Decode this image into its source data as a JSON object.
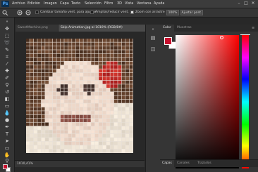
{
  "menubar": {
    "logo": "Ps",
    "items": [
      "Archivo",
      "Edición",
      "Imagen",
      "Capa",
      "Texto",
      "Selección",
      "Filtro",
      "3D",
      "Vista",
      "Ventana",
      "Ayuda"
    ],
    "window_controls": [
      "–",
      "□",
      "✕"
    ]
  },
  "options": {
    "resize_windows": "Cambiar tamaño vent. para ajustar",
    "zoom_all": "Ampliar/reducir vent.",
    "scrubby_zoom": "Zoom con arrastre",
    "percent": "100%",
    "fit_screen": "Ajustar pant."
  },
  "tabs": {
    "tab1": "SweetMachine.png",
    "tab2": "Skip Animation.jpg al 1010% (RGB/8#)"
  },
  "status": {
    "zoom": "1010,41%"
  },
  "color_panel": {
    "tab_color": "Color",
    "tab_swatches": "Muestras",
    "fg_color": "#c8102e",
    "bg_color": "#ffffff"
  },
  "bottom_tabs": {
    "layers": "Capas",
    "channels": "Canales",
    "paths": "Trazados"
  },
  "icons": {
    "tools": [
      "move-icon",
      "marquee-icon",
      "lasso-icon",
      "quick-select-icon",
      "crop-icon",
      "eyedropper-icon",
      "healing-icon",
      "brush-icon",
      "stamp-icon",
      "history-brush-icon",
      "eraser-icon",
      "gradient-icon",
      "blur-icon",
      "dodge-icon",
      "pen-icon",
      "type-icon",
      "path-select-icon",
      "shape-icon",
      "hand-icon",
      "zoom-icon"
    ]
  }
}
